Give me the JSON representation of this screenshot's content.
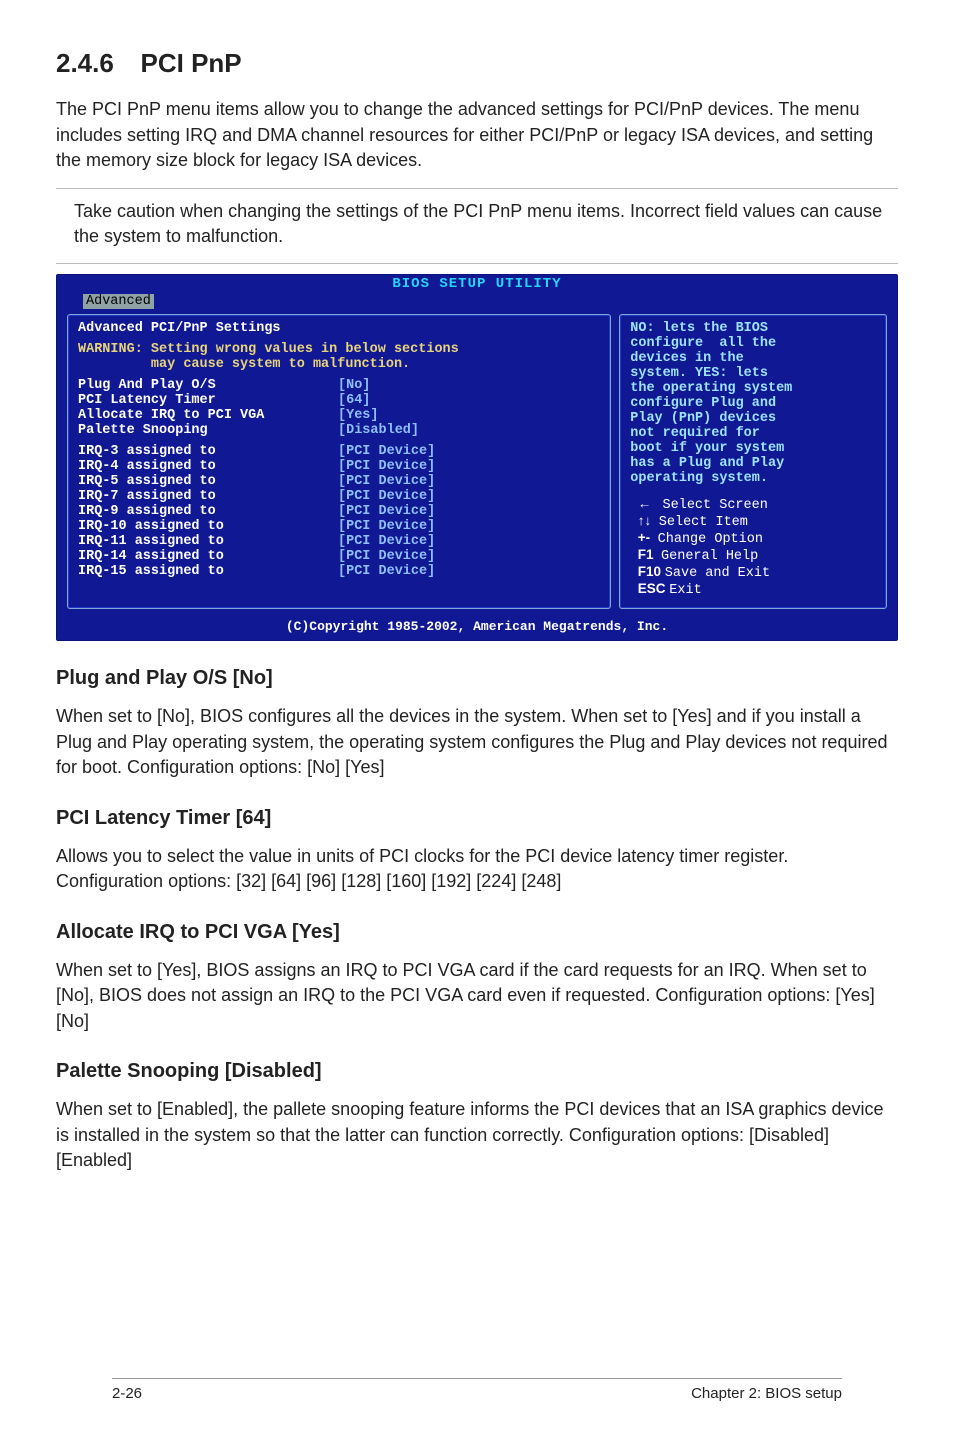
{
  "section": {
    "number": "2.4.6",
    "title": "PCI PnP"
  },
  "intro": "The PCI PnP menu items allow you to change the advanced settings for PCI/PnP devices. The menu includes setting IRQ and DMA channel resources for either PCI/PnP or legacy ISA devices, and setting the memory size block for legacy ISA devices.",
  "callout": "Take caution when changing the settings of the PCI PnP menu items. Incorrect field values can cause the system to malfunction.",
  "bios": {
    "title": "BIOS SETUP UTILITY",
    "active_tab": "Advanced",
    "left": {
      "header": "Advanced PCI/PnP Settings",
      "warn1": "WARNING: Setting wrong values in below sections",
      "warn2": "         may cause system to malfunction.",
      "rows": [
        {
          "label": "Plug And Play O/S",
          "value": "[No]"
        },
        {
          "label": "PCI Latency Timer",
          "value": "[64]"
        },
        {
          "label": "Allocate IRQ to PCI VGA",
          "value": "[Yes]"
        },
        {
          "label": "Palette Snooping",
          "value": "[Disabled]"
        }
      ],
      "irq": [
        {
          "label": "IRQ-3 assigned to",
          "value": "[PCI Device]"
        },
        {
          "label": "IRQ-4 assigned to",
          "value": "[PCI Device]"
        },
        {
          "label": "IRQ-5 assigned to",
          "value": "[PCI Device]"
        },
        {
          "label": "IRQ-7 assigned to",
          "value": "[PCI Device]"
        },
        {
          "label": "IRQ-9 assigned to",
          "value": "[PCI Device]"
        },
        {
          "label": "IRQ-10 assigned to",
          "value": "[PCI Device]"
        },
        {
          "label": "IRQ-11 assigned to",
          "value": "[PCI Device]"
        },
        {
          "label": "IRQ-14 assigned to",
          "value": "[PCI Device]"
        },
        {
          "label": "IRQ-15 assigned to",
          "value": "[PCI Device]"
        }
      ]
    },
    "right": {
      "help": [
        "NO: lets the BIOS",
        "configure  all the",
        "devices in the",
        "system. YES: lets",
        "the operating system",
        "configure Plug and",
        "Play (PnP) devices",
        "not required for",
        "boot if your system",
        "has a Plug and Play",
        "operating system."
      ],
      "keys": [
        {
          "sym": "←",
          "desc": "Select Screen"
        },
        {
          "sym": "↑↓",
          "desc": "Select Item"
        },
        {
          "sym": "+-",
          "desc": "Change Option"
        },
        {
          "sym": "F1",
          "desc": "General Help"
        },
        {
          "sym": "F10",
          "desc": "Save and Exit"
        },
        {
          "sym": "ESC",
          "desc": "Exit"
        }
      ]
    },
    "copyright": "(C)Copyright 1985-2002, American Megatrends, Inc."
  },
  "subsections": [
    {
      "heading": "Plug and Play O/S [No]",
      "body": "When set to [No], BIOS configures all the devices in the system. When set to [Yes] and if you install a Plug and Play operating system, the operating system configures the Plug and Play devices not required for boot. Configuration options: [No] [Yes]"
    },
    {
      "heading": "PCI Latency Timer [64]",
      "body": "Allows you to select the value in units of PCI clocks for the PCI device latency timer register. Configuration options: [32] [64] [96] [128] [160] [192] [224] [248]"
    },
    {
      "heading": "Allocate IRQ to PCI VGA [Yes]",
      "body": "When set to [Yes], BIOS assigns an IRQ to PCI VGA card if the card requests for an IRQ. When set to [No], BIOS does not assign an IRQ to the PCI VGA card even if requested. Configuration options: [Yes] [No]"
    },
    {
      "heading": "Palette Snooping [Disabled]",
      "body": "When set to [Enabled], the pallete snooping feature informs the PCI devices that an ISA graphics device is installed in the system so that the latter can function correctly. Configuration options: [Disabled] [Enabled]"
    }
  ],
  "footer": {
    "left": "2-26",
    "right": "Chapter 2: BIOS setup"
  }
}
